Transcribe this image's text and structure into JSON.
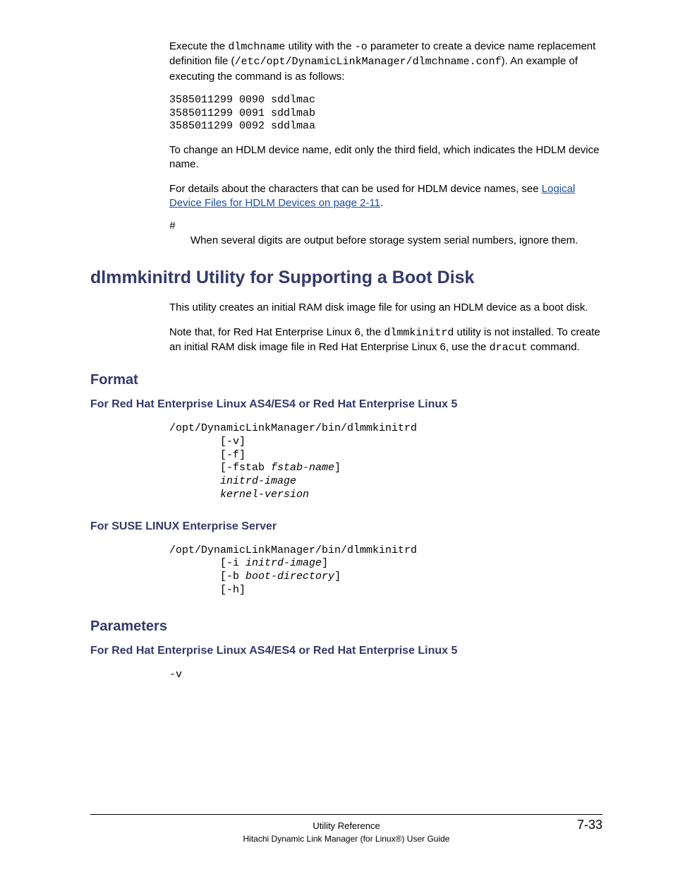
{
  "paragraphs": {
    "p1_pre": "Execute the ",
    "p1_mono1": "dlmchname",
    "p1_mid1": " utility with the ",
    "p1_mono2": "-o",
    "p1_mid2": " parameter to create a device name replacement definition file (",
    "p1_mono3": "/etc/opt/DynamicLinkManager/dlmchname.conf",
    "p1_post": "). An example of executing the command is as follows:",
    "code1": "3585011299 0090 sddlmac\n3585011299 0091 sddlmab\n3585011299 0092 sddlmaa",
    "p2": "To change an HDLM device name, edit only the third field, which indicates the HDLM device name.",
    "p3_pre": "For details about the characters that can be used for HDLM device names, see ",
    "p3_link": "Logical Device Files for HDLM Devices on page 2-11",
    "p3_post": ".",
    "hash": "#",
    "note": "When several digits are output before storage system serial numbers, ignore them."
  },
  "h1": "dlmmkinitrd Utility for Supporting a Boot Disk",
  "section1": {
    "p1": "This utility creates an initial RAM disk image file for using an HDLM device as a boot disk.",
    "p2_pre": "Note that, for Red Hat Enterprise Linux 6, the ",
    "p2_mono1": "dlmmkinitrd",
    "p2_mid": " utility is not installed. To create an initial RAM disk image file in Red Hat Enterprise Linux 6, use the ",
    "p2_mono2": "dracut",
    "p2_post": " command."
  },
  "format": {
    "heading": "Format",
    "sub1": "For Red Hat Enterprise Linux AS4/ES4 or Red Hat Enterprise Linux 5",
    "code1_l1": "/opt/DynamicLinkManager/bin/dlmmkinitrd",
    "code1_l2": "        [-v]",
    "code1_l3": "        [-f]",
    "code1_l4a": "        [-fstab ",
    "code1_l4b": "fstab-name",
    "code1_l4c": "]",
    "code1_l5": "initrd-image",
    "code1_l6": "kernel-version",
    "sub2": "For SUSE LINUX Enterprise Server",
    "code2_l1": "/opt/DynamicLinkManager/bin/dlmmkinitrd",
    "code2_l2a": "        [-i ",
    "code2_l2b": "initrd-image",
    "code2_l2c": "]",
    "code2_l3a": "        [-b ",
    "code2_l3b": "boot-directory",
    "code2_l3c": "]",
    "code2_l4": "        [-h]"
  },
  "params": {
    "heading": "Parameters",
    "sub1": "For Red Hat Enterprise Linux AS4/ES4 or Red Hat Enterprise Linux 5",
    "v": "-v"
  },
  "footer": {
    "center": "Utility Reference",
    "right": "7-33",
    "sub": "Hitachi Dynamic Link Manager (for Linux®) User Guide"
  }
}
